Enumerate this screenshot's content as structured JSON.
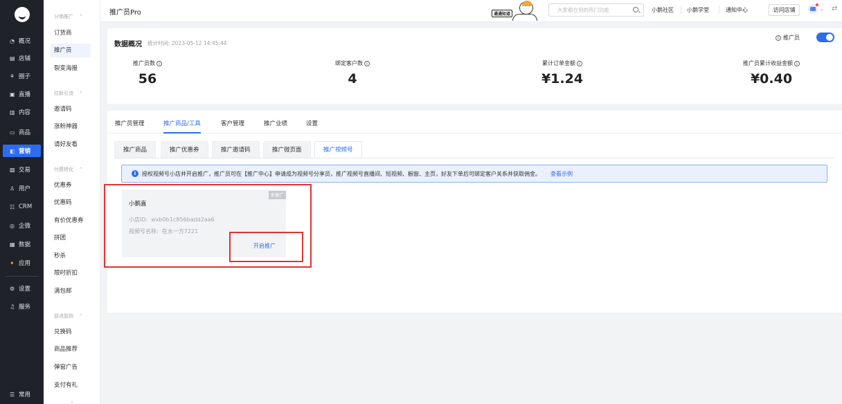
{
  "rail": {
    "items": [
      {
        "icon": "◔",
        "label": "概况"
      },
      {
        "icon": "▤",
        "label": "店铺"
      },
      {
        "icon": "⚘",
        "label": "圈子"
      },
      {
        "icon": "▣",
        "label": "直播"
      },
      {
        "icon": "▥",
        "label": "内容"
      },
      {
        "icon": "▭",
        "label": "商品"
      },
      {
        "icon": "◧",
        "label": "营销"
      },
      {
        "icon": "▧",
        "label": "交易"
      },
      {
        "icon": "♙",
        "label": "用户"
      },
      {
        "icon": "☷",
        "label": "CRM"
      },
      {
        "icon": "◎",
        "label": "企微"
      },
      {
        "icon": "▦",
        "label": "数据"
      },
      {
        "icon": "✦",
        "label": "应用"
      },
      {
        "icon": "⚙",
        "label": "设置"
      },
      {
        "icon": "♫",
        "label": "服务"
      }
    ],
    "bottom": {
      "icon": "☰",
      "label": "常用"
    },
    "active_index": 6
  },
  "subnav": {
    "groups": [
      {
        "title": "分销推广",
        "items": [
          "订货商",
          "推广员",
          "裂变海报"
        ]
      },
      {
        "title": "拉新引流",
        "items": [
          "邀请码",
          "涨粉神器",
          "请好友看"
        ]
      },
      {
        "title": "付费转化",
        "items": [
          "优惠券",
          "优惠码",
          "有价优惠券",
          "拼团",
          "秒杀",
          "限时折扣",
          "满包邮"
        ]
      },
      {
        "title": "促进复购",
        "items": [
          "兑换码",
          "商品推荐",
          "弹窗广告",
          "支付有礼"
        ]
      }
    ],
    "active_item": "推广员"
  },
  "topbar": {
    "title": "推广员Pro",
    "badge": "通通知道",
    "search_placeholder": "大家都在用的热门功能",
    "links": [
      "小鹅社区",
      "小鹅学堂",
      "通知中心"
    ],
    "visit_button": "访问店铺"
  },
  "overview": {
    "title": "数据概况",
    "time": "统计时间: 2023-05-12 14:45:44",
    "toggle_label": "推广员",
    "toggle_on": true,
    "stats": [
      {
        "label": "推广员数",
        "value": "56"
      },
      {
        "label": "绑定客户数",
        "value": "4"
      },
      {
        "label": "累计订单金额",
        "value": "¥1.24"
      },
      {
        "label": "推广员累计收益金额",
        "value": "¥0.40"
      }
    ]
  },
  "tabs": [
    "推广员管理",
    "推广商品/工具",
    "客户管理",
    "推广业绩",
    "设置"
  ],
  "active_tab": 1,
  "subtabs": [
    "推广商品",
    "推广优惠券",
    "推广邀请码",
    "推广微页面",
    "推广视频号"
  ],
  "active_subtab": 4,
  "notice": {
    "text": "授权视频号小店并开启推广，推广员可在【推广中心】申请成为视频号分享员，推广视频号直播间、短视频、橱窗、主页，好友下单后可绑定客户关系并获取佣金。",
    "link": "查看示例"
  },
  "shop_card": {
    "tag": "未推广",
    "name": "小鹅直",
    "shop_id_label": "小店ID:",
    "shop_id": "wxb0b1c856badd2aa6",
    "channel_label": "视频号名称:",
    "channel": "在水一方7221",
    "action": "开启推广"
  },
  "colors": {
    "accent": "#2c6df0",
    "highlight": "#e0322f",
    "rail_bg": "#1f2229"
  }
}
